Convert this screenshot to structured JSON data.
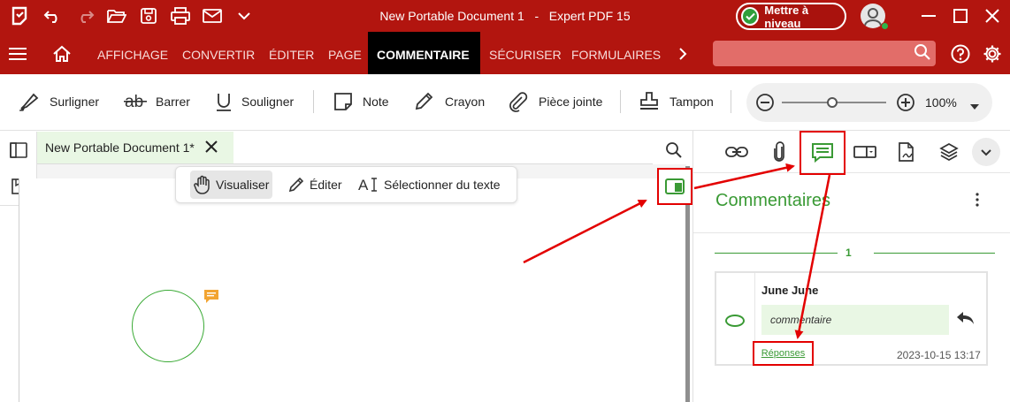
{
  "titlebar": {
    "document_name": "New Portable Document 1",
    "separator": "-",
    "app_name": "Expert PDF 15",
    "upgrade_label": "Mettre à niveau"
  },
  "menu": {
    "items": [
      "AFFICHAGE",
      "CONVERTIR",
      "ÉDITER",
      "PAGE",
      "COMMENTAIRE",
      "SÉCURISER",
      "FORMULAIRES"
    ],
    "active": "COMMENTAIRE",
    "search_placeholder": ""
  },
  "ribbon": {
    "tools": [
      "Surligner",
      "Barrer",
      "Souligner",
      "Note",
      "Crayon",
      "Pièce jointe",
      "Tampon"
    ],
    "zoom_value": "100%",
    "zoom_level": 0.48
  },
  "document": {
    "tab_label": "New Portable Document 1*",
    "modes": [
      "Visualiser",
      "Éditer",
      "Sélectionner du texte"
    ],
    "active_mode": "Visualiser"
  },
  "comments_panel": {
    "title": "Commentaires",
    "page_number": "1",
    "comment": {
      "author": "June June",
      "text": "commentaire",
      "replies_label": "Réponses",
      "date": "2023-10-15 13:17"
    }
  },
  "colors": {
    "brand_red": "#b2150f",
    "accent_green": "#3a9a35",
    "highlight_box": "#e30000"
  }
}
